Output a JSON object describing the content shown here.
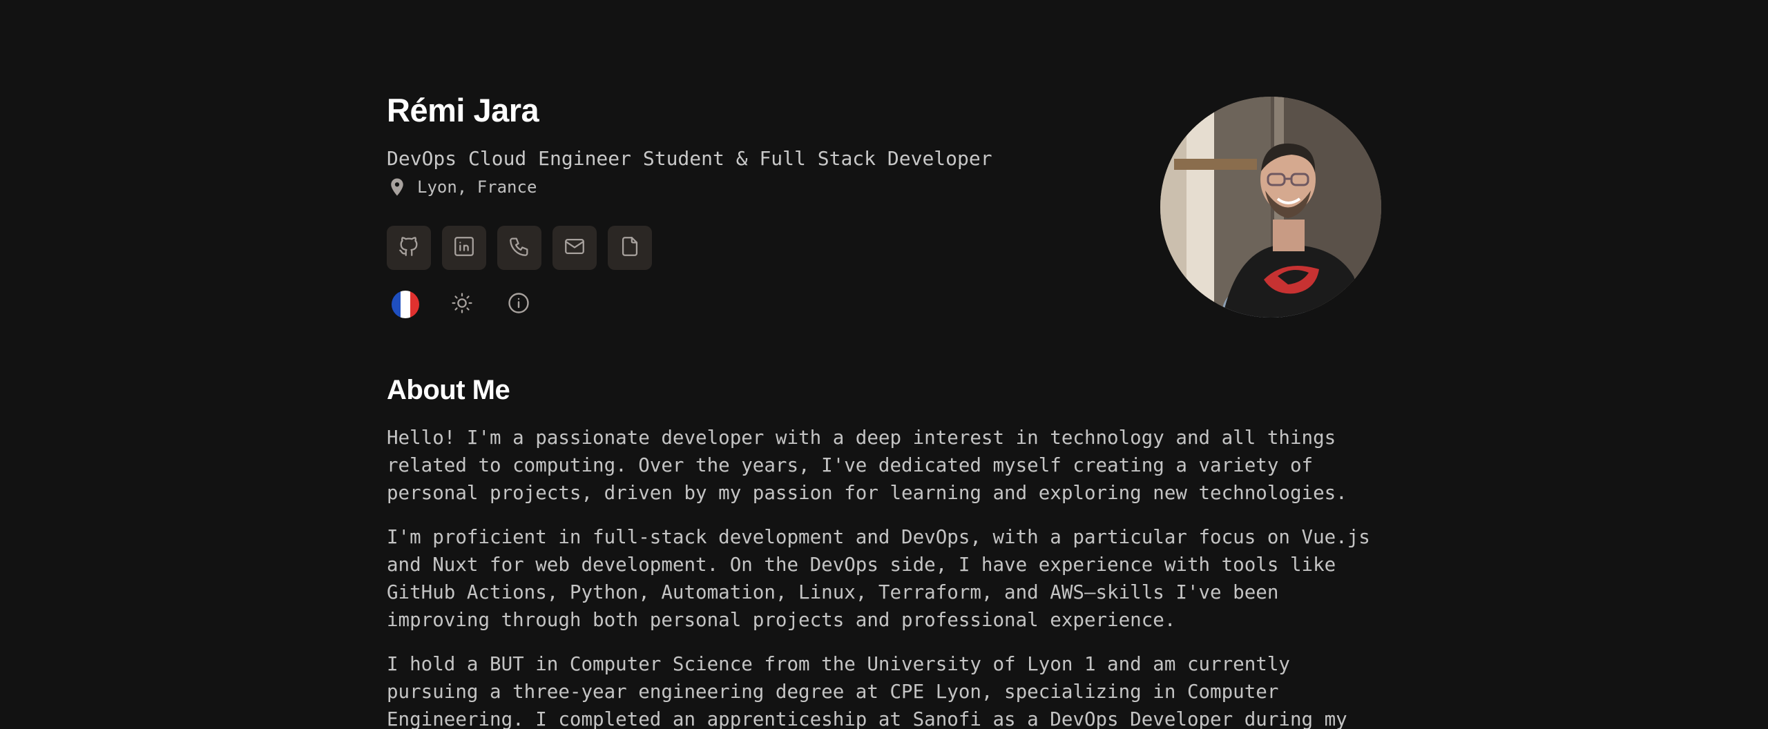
{
  "header": {
    "name": "Rémi Jara",
    "tagline": "DevOps Cloud Engineer Student & Full Stack Developer",
    "location": "Lyon, France"
  },
  "socials": [
    {
      "icon": "github-icon",
      "label": "GitHub"
    },
    {
      "icon": "linkedin-icon",
      "label": "LinkedIn"
    },
    {
      "icon": "phone-icon",
      "label": "Phone"
    },
    {
      "icon": "mail-icon",
      "label": "Email"
    },
    {
      "icon": "document-icon",
      "label": "Resume"
    }
  ],
  "utilities": [
    {
      "icon": "france-flag-icon",
      "label": "Language"
    },
    {
      "icon": "sun-icon",
      "label": "Theme"
    },
    {
      "icon": "info-icon",
      "label": "Info"
    }
  ],
  "about": {
    "title": "About Me",
    "paragraphs": [
      "Hello! I'm a passionate developer with a deep interest in technology and all things related to computing. Over the years, I've dedicated myself creating a variety of personal projects, driven by my passion for learning and exploring new technologies.",
      "I'm proficient in full-stack development and DevOps, with a particular focus on Vue.js and Nuxt for web development. On the DevOps side, I have experience with tools like GitHub Actions, Python, Automation, Linux, Terraform, and AWS—skills I've been improving through both personal projects and professional experience.",
      "I hold a BUT in Computer Science from the University of Lyon 1 and am currently pursuing a three-year engineering degree at CPE Lyon, specializing in Computer Engineering. I completed an apprenticeship at Sanofi as a DevOps Developer during my"
    ]
  },
  "colors": {
    "background": "#121212",
    "button_bg": "#2b2724",
    "icon": "#a8a29e",
    "heading": "#ffffff",
    "text": "#c4c4c4",
    "flag_blue": "#1f4fbf",
    "flag_white": "#ffffff",
    "flag_red": "#e0312f"
  }
}
